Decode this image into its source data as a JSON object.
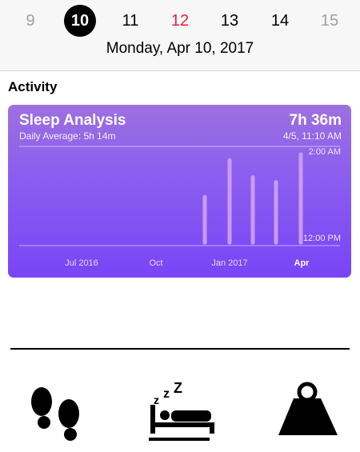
{
  "calendar": {
    "days": [
      "9",
      "10",
      "11",
      "12",
      "13",
      "14",
      "15"
    ],
    "selected_date": "Monday, Apr 10, 2017"
  },
  "section_title": "Activity",
  "sleep_card": {
    "title": "Sleep Analysis",
    "subtitle": "Daily Average: 5h 14m",
    "value": "7h 36m",
    "timestamp": "4/5, 11:10 AM",
    "colors": {
      "gradient_top": "#9d70e0",
      "gradient_bottom": "#7a44f6",
      "bar": "#c89bf6"
    }
  },
  "chart_data": {
    "type": "bar",
    "y_tick_labels": [
      "2:00 AM",
      "12:00 PM"
    ],
    "x_tick_labels": [
      "Jul 2016",
      "Oct",
      "Jan 2017",
      "Apr"
    ],
    "bars": [
      {
        "start": 0.49,
        "end": 0.99
      },
      {
        "start": 0.12,
        "end": 0.99
      },
      {
        "start": 0.29,
        "end": 0.99
      },
      {
        "start": 0.34,
        "end": 0.99
      },
      {
        "start": 0.06,
        "end": 0.99
      }
    ]
  },
  "tabs": [
    {
      "name": "activity-tab",
      "icon": "footprints-icon"
    },
    {
      "name": "sleep-tab",
      "icon": "sleep-bed-icon",
      "selected": true
    },
    {
      "name": "weight-tab",
      "icon": "weight-icon"
    }
  ]
}
